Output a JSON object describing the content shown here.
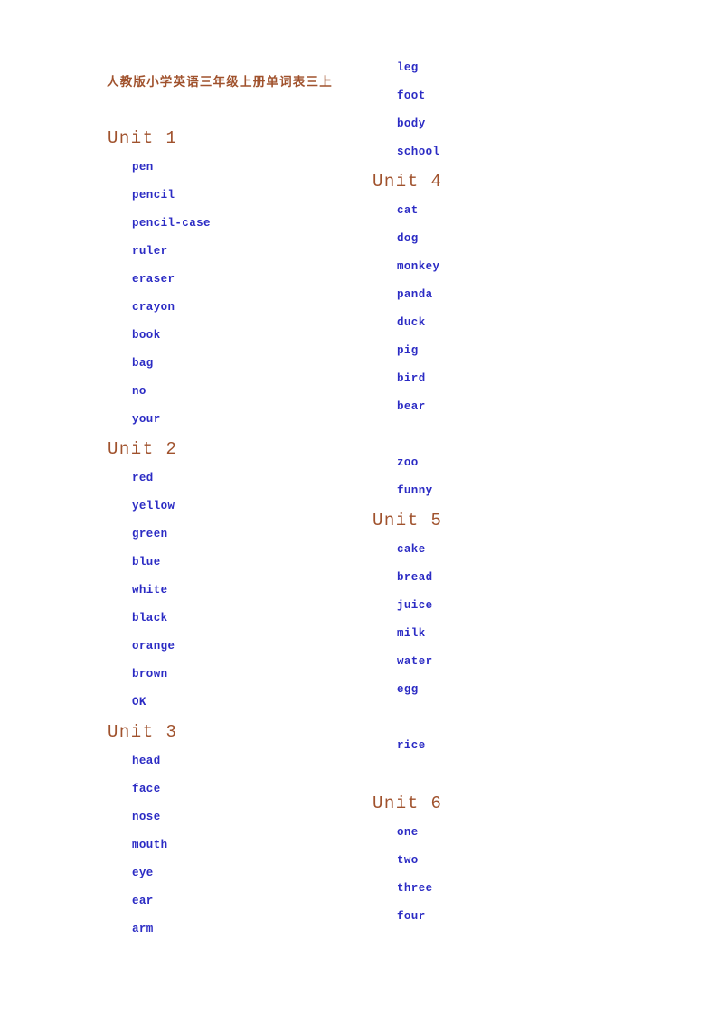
{
  "document": {
    "title": "人教版小学英语三年级上册单词表三上",
    "title_color": "#A0522D",
    "word_color": "#2B2BC4",
    "background": "#FFFFFF"
  },
  "columns": [
    {
      "name": "left-column",
      "blocks": [
        {
          "type": "unit",
          "heading": "Unit 1",
          "words": [
            "pen",
            "pencil",
            "pencil-case",
            "ruler",
            "eraser",
            "crayon",
            "book",
            "bag",
            "no",
            "your"
          ]
        },
        {
          "type": "unit",
          "heading": "Unit 2",
          "words": [
            "red",
            "yellow",
            "green",
            "blue",
            "white",
            "black",
            "orange",
            "brown",
            "OK"
          ]
        },
        {
          "type": "unit",
          "heading": "Unit 3",
          "words": [
            "head",
            "face",
            "nose",
            "mouth",
            "eye",
            "ear",
            "arm"
          ]
        }
      ]
    },
    {
      "name": "right-column",
      "blocks": [
        {
          "type": "continuation",
          "heading": "",
          "words": [
            "leg",
            "foot",
            "body",
            "school"
          ]
        },
        {
          "type": "unit",
          "heading": "Unit 4",
          "words": [
            "cat",
            "dog",
            "monkey",
            "panda",
            "duck",
            "pig",
            "bird",
            "bear",
            "",
            "zoo",
            "funny"
          ]
        },
        {
          "type": "unit",
          "heading": "Unit 5",
          "words": [
            "cake",
            "bread",
            "juice",
            "milk",
            "water",
            "egg",
            "",
            "rice",
            ""
          ]
        },
        {
          "type": "unit",
          "heading": "Unit 6",
          "words": [
            "one",
            "two",
            "three",
            "four"
          ]
        }
      ]
    }
  ]
}
